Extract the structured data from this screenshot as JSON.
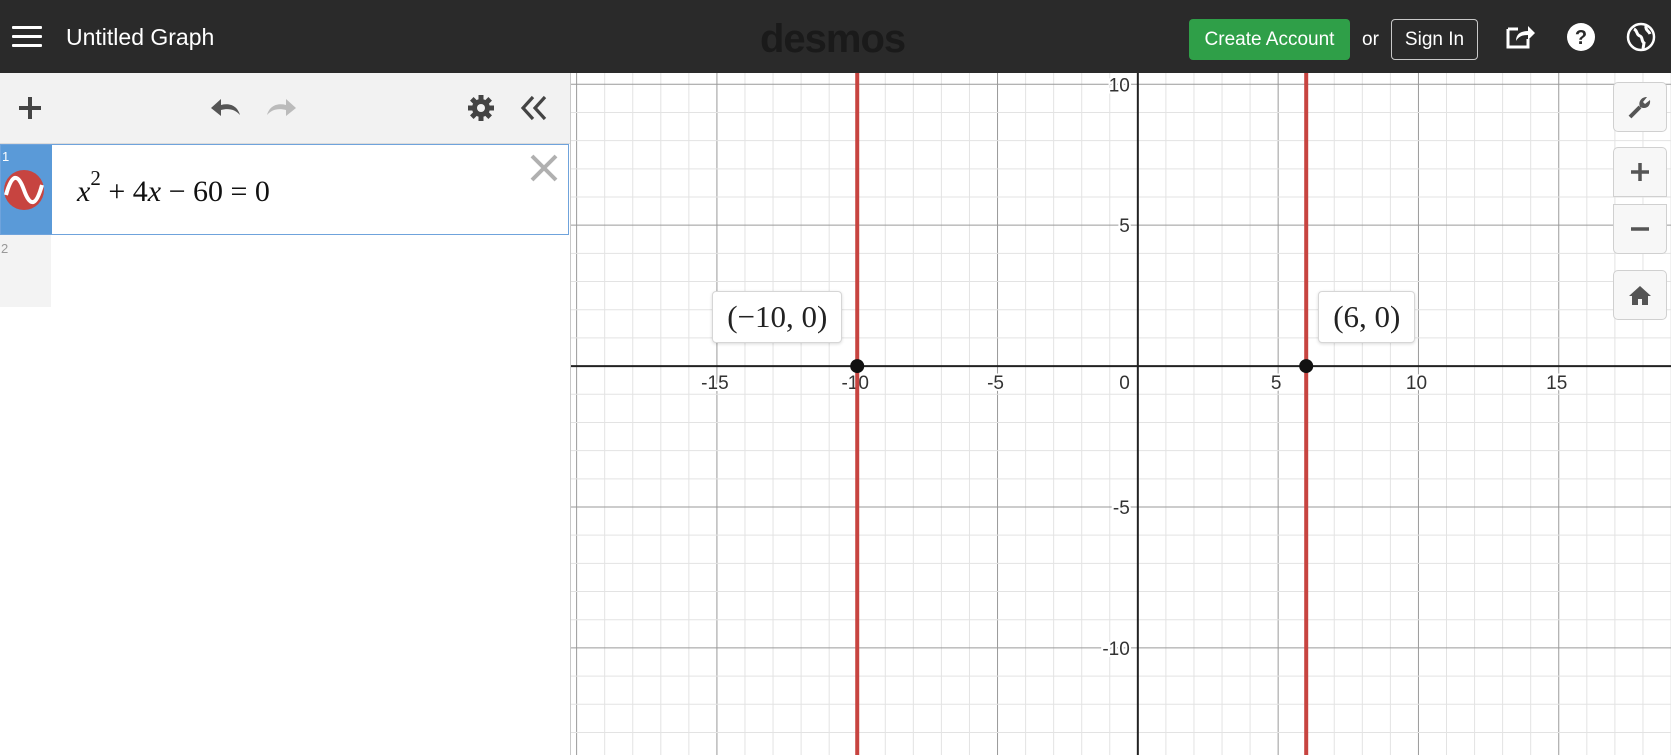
{
  "header": {
    "title": "Untitled Graph",
    "logo": "desmos",
    "create_account": "Create Account",
    "or": "or",
    "sign_in": "Sign In",
    "icons": [
      "menu-icon",
      "share-icon",
      "help-icon",
      "language-globe-icon"
    ]
  },
  "toolbar": {
    "icons": [
      "add-icon",
      "undo-icon",
      "redo-icon",
      "settings-gear-icon",
      "collapse-panel-icon"
    ]
  },
  "expressions": [
    {
      "index": "1",
      "latex_parts": {
        "x": "x",
        "exp": "2",
        "rest_a": "+ 4",
        "x2": "x",
        "rest_b": "− 60 = 0"
      },
      "color": "#c74440"
    },
    {
      "index": "2",
      "empty": true
    }
  ],
  "graph": {
    "x_range": [
      -20.2,
      19
    ],
    "y_range": [
      -13.8,
      10.4
    ],
    "x_ticks": [
      "-15",
      "-10",
      "-5",
      "0",
      "5",
      "10",
      "15"
    ],
    "y_ticks": [
      "10",
      "5",
      "-5",
      "-10"
    ],
    "lines": [
      {
        "x": -10,
        "color": "#c74440"
      },
      {
        "x": 6,
        "color": "#c74440"
      }
    ],
    "points": [
      {
        "x": -10,
        "y": 0,
        "label": "(−10, 0)"
      },
      {
        "x": 6,
        "y": 0,
        "label": "(6, 0)"
      }
    ]
  },
  "graph_controls": {
    "icons": [
      "wrench-icon",
      "zoom-in-icon",
      "zoom-out-icon",
      "home-icon"
    ]
  },
  "colors": {
    "topbar": "#2a2a2a",
    "create_button": "#2f9f48",
    "expression_gutter": "#5a9ad8",
    "curve": "#c74440"
  }
}
